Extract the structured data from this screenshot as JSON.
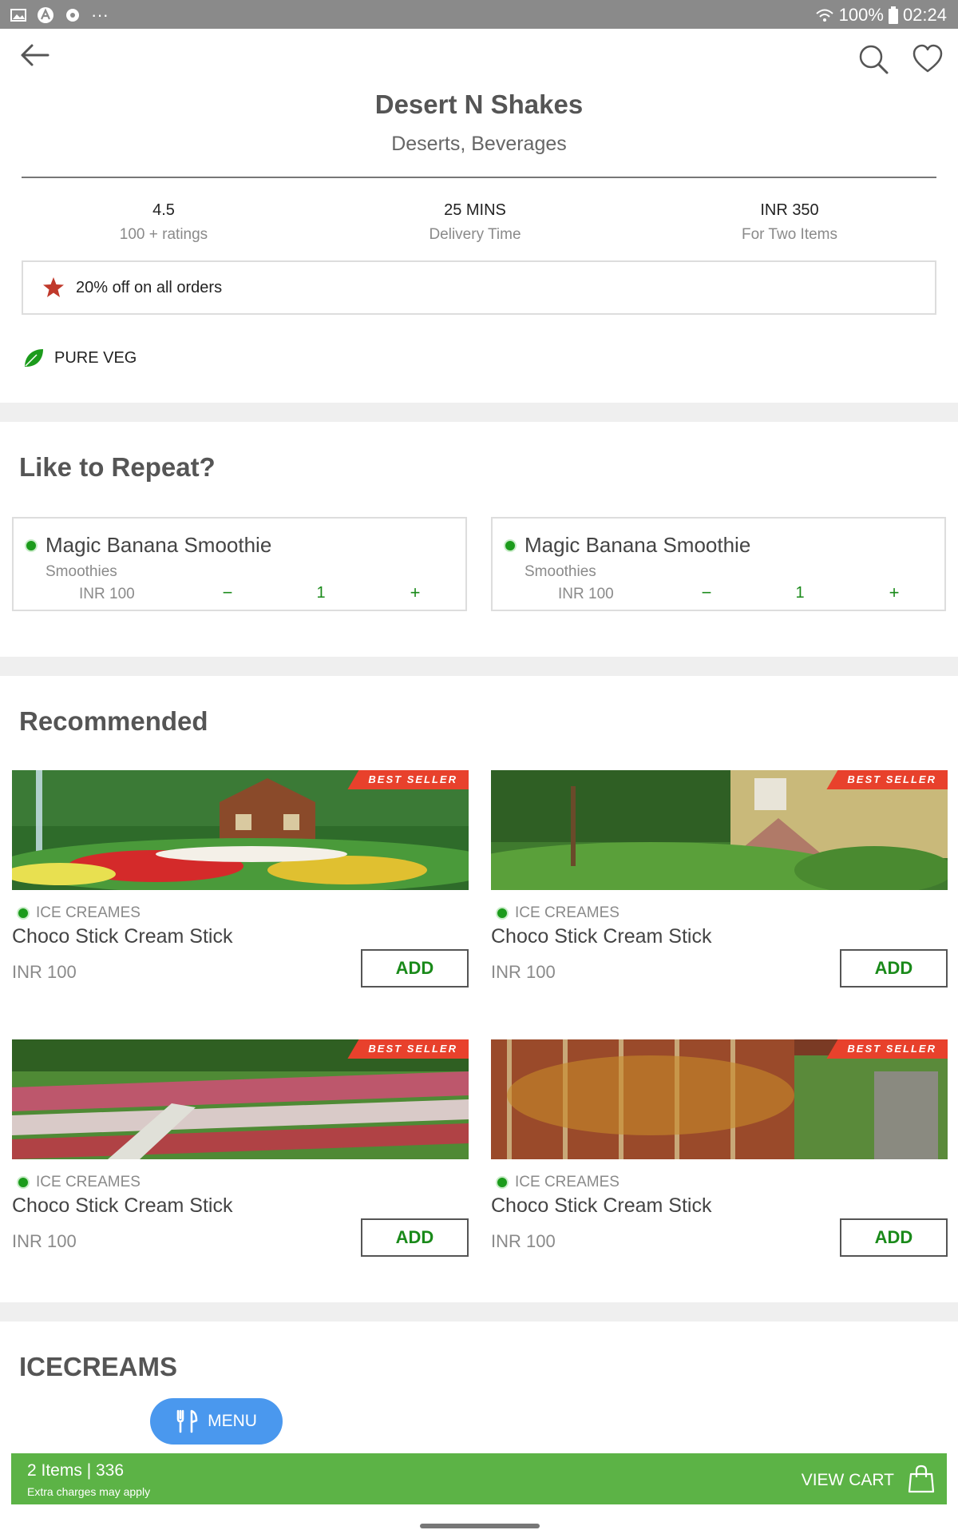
{
  "status_bar": {
    "battery": "100%",
    "time": "02:24",
    "more_indicator": "···"
  },
  "restaurant": {
    "name": "Desert N Shakes",
    "categories": "Deserts, Beverages"
  },
  "stats": [
    {
      "value": "4.5",
      "label": "100 + ratings"
    },
    {
      "value": "25 MINS",
      "label": "Delivery Time"
    },
    {
      "value": "INR 350",
      "label": "For Two Items"
    }
  ],
  "offer": {
    "text": "20% off on all orders",
    "icon": "star-icon",
    "icon_color": "#c0392b"
  },
  "veg": {
    "label": "PURE VEG",
    "icon": "leaf-icon",
    "color": "#1c9b1c"
  },
  "repeat_section": {
    "title": "Like to Repeat?",
    "items": [
      {
        "name": "Magic Banana Smoothie",
        "category": "Smoothies",
        "price": "INR 100",
        "minus": "−",
        "qty": "1",
        "plus": "+"
      },
      {
        "name": "Magic Banana Smoothie",
        "category": "Smoothies",
        "price": "INR 100",
        "minus": "−",
        "qty": "1",
        "plus": "+"
      }
    ]
  },
  "recommended_section": {
    "title": "Recommended",
    "items": [
      {
        "badge": "BEST SELLER",
        "category": "ICE CREAMES",
        "name": "Choco Stick Cream Stick",
        "price": "INR 100",
        "add_label": "ADD"
      },
      {
        "badge": "BEST SELLER",
        "category": "ICE CREAMES",
        "name": "Choco Stick Cream Stick",
        "price": "INR 100",
        "add_label": "ADD"
      },
      {
        "badge": "BEST SELLER",
        "category": "ICE CREAMES",
        "name": "Choco Stick Cream Stick",
        "price": "INR 100",
        "add_label": "ADD"
      },
      {
        "badge": "BEST SELLER",
        "category": "ICE CREAMES",
        "name": "Choco Stick Cream Stick",
        "price": "INR 100",
        "add_label": "ADD"
      }
    ]
  },
  "icecreams_section": {
    "title": "ICECREAMS"
  },
  "menu_button": {
    "label": "MENU",
    "icon": "cutlery-icon"
  },
  "cart": {
    "summary": "2 Items | 336",
    "note": "Extra charges may apply",
    "action": "VIEW CART",
    "icon": "shopping-bag-icon",
    "color": "#5cb346"
  },
  "colors": {
    "accent_green": "#1a8a1a",
    "menu_blue": "#4a98ee",
    "ribbon_red": "#e8412c"
  }
}
